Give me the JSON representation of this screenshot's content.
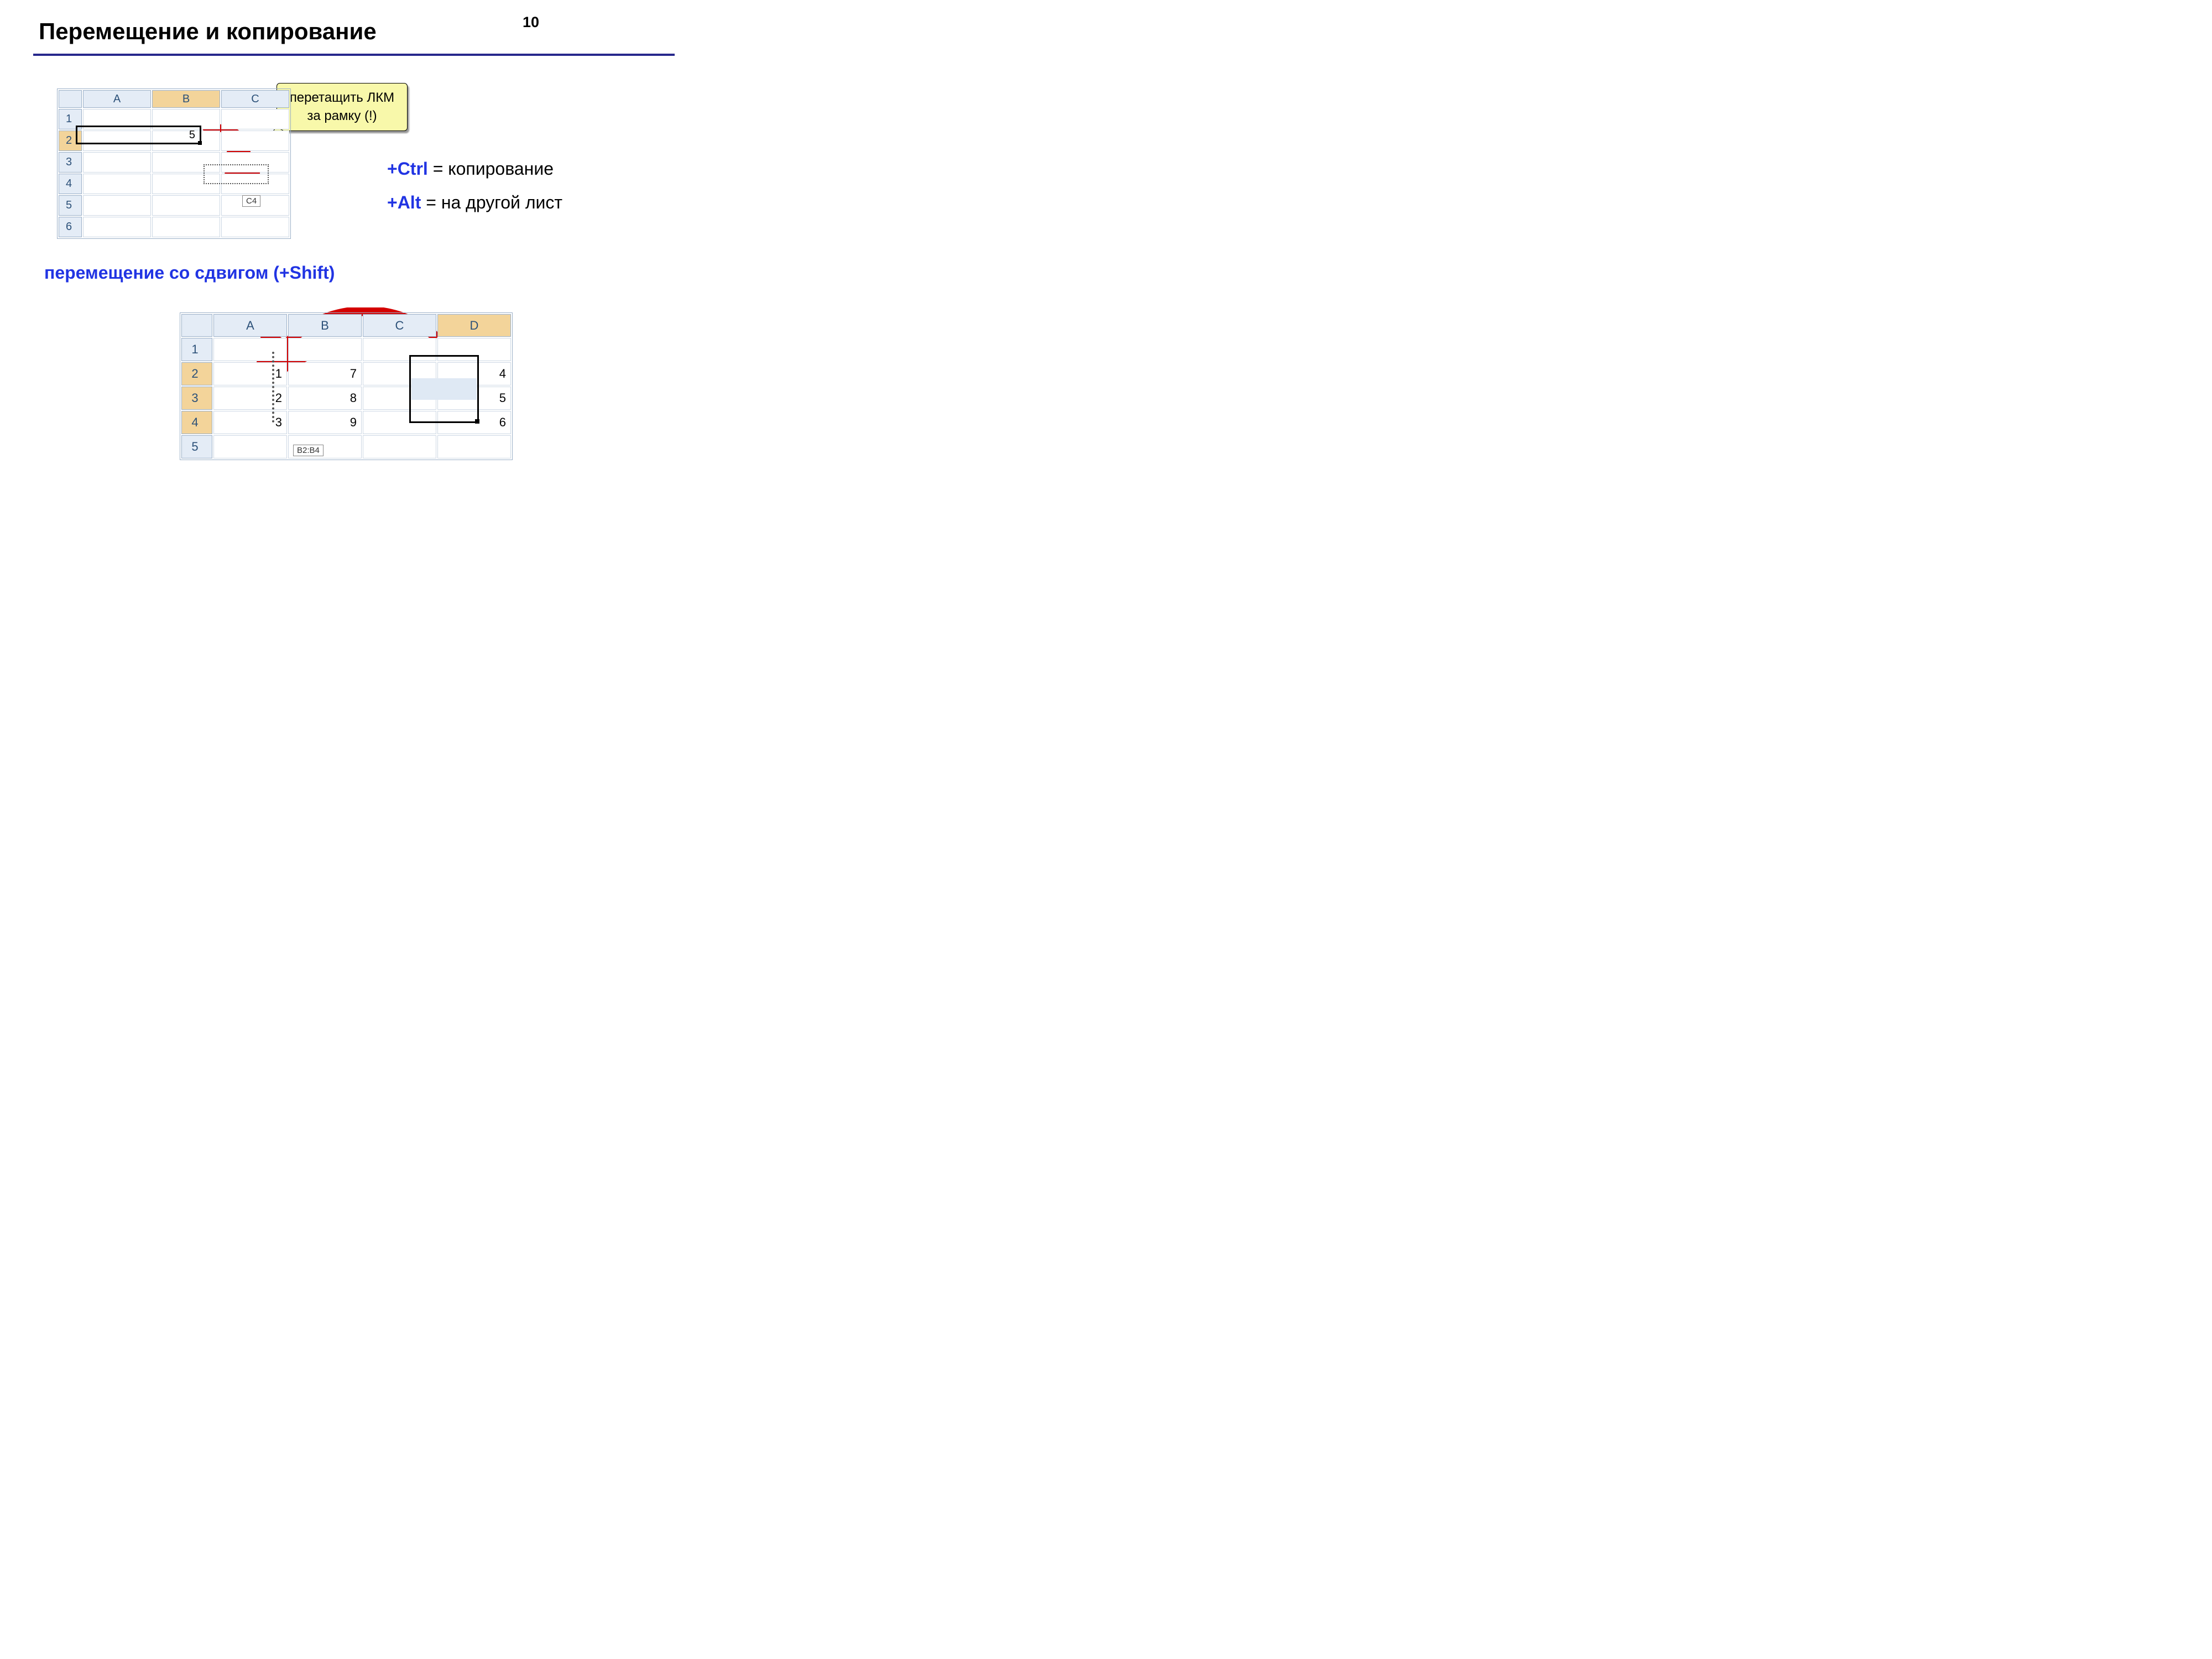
{
  "page_number": "10",
  "title": "Перемещение и копирование",
  "callout": "перетащить ЛКМ\nза рамку (!)",
  "mods": {
    "ctrl_key": "+Ctrl",
    "ctrl_text": " = копирование",
    "alt_key": "+Alt",
    "alt_text": " = на другой лист"
  },
  "subheading": "перемещение со сдвигом (+Shift)",
  "sheet1": {
    "cols": [
      "A",
      "B",
      "C"
    ],
    "rows": [
      "1",
      "2",
      "3",
      "4",
      "5",
      "6"
    ],
    "selected_col_index": 1,
    "selected_row_index": 1,
    "active_cell_value": "5",
    "ref_tip": "C4"
  },
  "sheet2": {
    "cols": [
      "A",
      "B",
      "C",
      "D"
    ],
    "rows": [
      "1",
      "2",
      "3",
      "4",
      "5"
    ],
    "selected_col_index": 3,
    "selected_row_indices": [
      1,
      2,
      3
    ],
    "data": {
      "A2": "1",
      "A3": "2",
      "A4": "3",
      "B2": "7",
      "B3": "8",
      "B4": "9",
      "D2": "4",
      "D3": "5",
      "D4": "6"
    },
    "ref_tip": "B2:B4"
  }
}
